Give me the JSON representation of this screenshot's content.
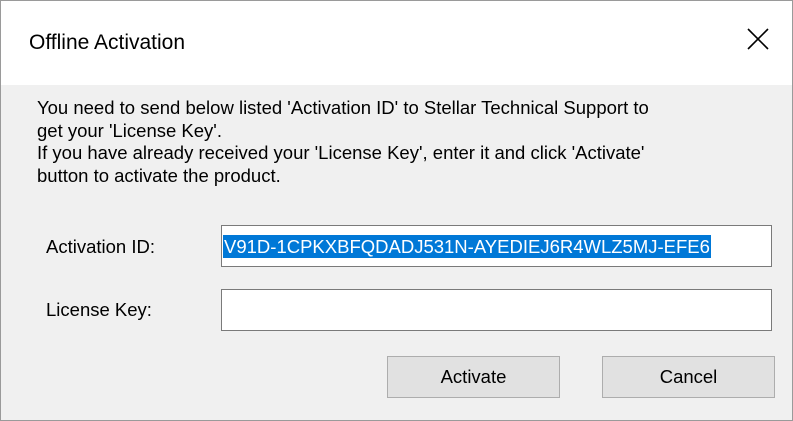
{
  "window": {
    "title": "Offline Activation"
  },
  "message": {
    "lines": [
      "You need to send below listed 'Activation ID' to Stellar Technical Support to",
      "get your 'License Key'.",
      "If you have already received your 'License Key', enter it and click 'Activate'",
      "button to activate the product."
    ]
  },
  "form": {
    "activation_id_label": "Activation ID:",
    "activation_id_value": "V91D-1CPKXBFQDADJ531N-AYEDIEJ6R4WLZ5MJ-EFE6",
    "license_key_label": "License Key:",
    "license_key_value": ""
  },
  "buttons": {
    "activate_label": "Activate",
    "cancel_label": "Cancel"
  },
  "colors": {
    "selection": "#0078d7",
    "dialog_bg": "#f0f0f0",
    "button_bg": "#e1e1e1"
  },
  "icons": {
    "close": "close-icon"
  }
}
